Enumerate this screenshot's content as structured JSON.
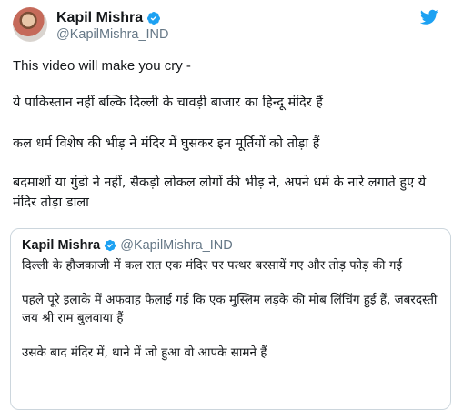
{
  "tweet": {
    "author": {
      "display_name": "Kapil Mishra",
      "handle": "@KapilMishra_IND",
      "verified": true
    },
    "paragraphs": [
      "This video will make you cry -",
      "ये पाकिस्तान नहीं बल्कि दिल्ली के चावड़ी बाजार का हिन्दू मंदिर हैं",
      "कल धर्म विशेष की भीड़ ने मंदिर में घुसकर इन मूर्तियों को तोड़ा हैं",
      "बदमाशों या गुंडो ने नहीं, सैकड़ो लोकल लोगों की भीड़ ने, अपने धर्म के नारे लगाते हुए ये मंदिर तोड़ा डाला"
    ],
    "quoted": {
      "display_name": "Kapil Mishra",
      "handle": "@KapilMishra_IND",
      "verified": true,
      "paragraphs": [
        "दिल्ली के हौजकाजी में कल रात एक मंदिर पर पत्थर बरसायें गए और तोड़ फोड़ की गई",
        "पहले पूरे इलाके में अफवाह फैलाई गई कि एक मुस्लिम लड़के की मोब लिंचिंग हुई हैं, जबरदस्ती जय श्री राम बुलवाया हैं",
        "उसके बाद मंदिर में, थाने में जो हुआ वो आपके सामने हैं"
      ]
    }
  },
  "icons": {
    "verified": "verified-badge-icon",
    "brand": "twitter-bird-icon"
  },
  "colors": {
    "brand": "#1da1f2",
    "text": "#14171a",
    "muted": "#657786",
    "border": "#ccd6dd"
  }
}
